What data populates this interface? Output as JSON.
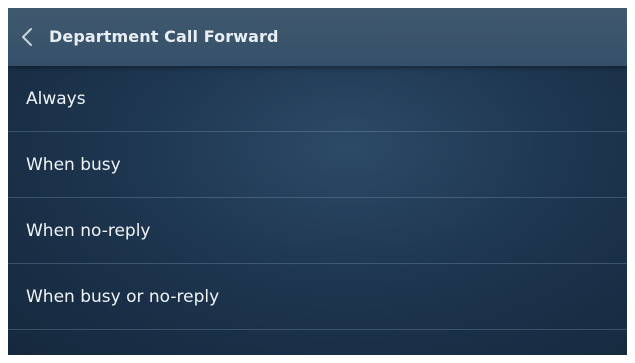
{
  "header": {
    "title": "Department Call Forward",
    "back_icon": "chevron-left-icon"
  },
  "menu": {
    "items": [
      {
        "label": "Always"
      },
      {
        "label": "When busy"
      },
      {
        "label": "When no-reply"
      },
      {
        "label": "When busy or no-reply"
      }
    ]
  },
  "colors": {
    "header_bg": "#3b546c",
    "screen_bg": "#1e3650",
    "text": "#f0f4f7",
    "divider": "#5f7a94"
  }
}
